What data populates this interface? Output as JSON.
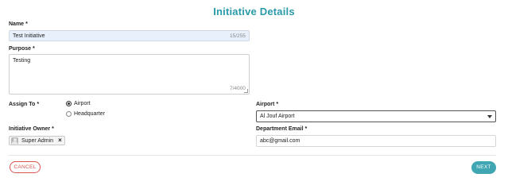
{
  "page": {
    "title": "Initiative Details"
  },
  "form": {
    "name": {
      "label": "Name",
      "required": "*",
      "value": "Test Initiative",
      "counter": "15/255"
    },
    "purpose": {
      "label": "Purpose",
      "required": "*",
      "value": "Testing",
      "counter": "7/4000"
    },
    "assign_to": {
      "label": "Assign To",
      "required": "*",
      "options": [
        {
          "label": "Airport",
          "checked": true
        },
        {
          "label": "Headquarter",
          "checked": false
        }
      ]
    },
    "airport": {
      "label": "Airport",
      "required": "*",
      "value": "Al Jouf Airport"
    },
    "initiative_owner": {
      "label": "Initiative Owner",
      "required": "*",
      "chip": "Super Admin",
      "chip_icon": "avatar-icon",
      "remove_icon": "close-icon"
    },
    "department_email": {
      "label": "Department Email",
      "required": "*",
      "value": "abc@gmail.com"
    }
  },
  "actions": {
    "cancel": "CANCEL",
    "next": "NEXT"
  },
  "colors": {
    "title": "#2a9aa8",
    "next_button": "#3fa6b2",
    "cancel_button": "#d9534f",
    "name_field_bg": "#e8f0fb"
  }
}
